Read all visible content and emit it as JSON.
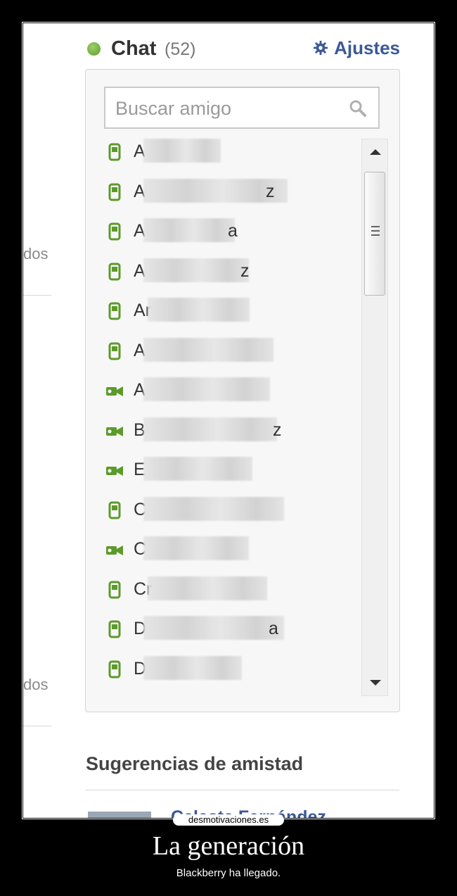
{
  "chat": {
    "title": "Chat",
    "count": "(52)",
    "settings_label": "Ajustes",
    "search_placeholder": "Buscar amigo"
  },
  "left_fragments": [
    "dos",
    "dos"
  ],
  "friends": [
    {
      "initial": "A",
      "device": "mobile-icon",
      "tail": ""
    },
    {
      "initial": "A",
      "device": "mobile-icon",
      "tail": "z"
    },
    {
      "initial": "A",
      "device": "mobile-icon",
      "tail": "a"
    },
    {
      "initial": "A",
      "device": "mobile-icon",
      "tail": "z"
    },
    {
      "initial": "Ar",
      "device": "mobile-icon",
      "tail": ""
    },
    {
      "initial": "A",
      "device": "mobile-icon",
      "tail": ""
    },
    {
      "initial": "A",
      "device": "video-icon",
      "tail": ""
    },
    {
      "initial": "B",
      "device": "video-icon",
      "tail": "z"
    },
    {
      "initial": "E",
      "device": "video-icon",
      "tail": ""
    },
    {
      "initial": "C",
      "device": "mobile-icon",
      "tail": ""
    },
    {
      "initial": "C",
      "device": "video-icon",
      "tail": ""
    },
    {
      "initial": "Cr",
      "device": "mobile-icon",
      "tail": ""
    },
    {
      "initial": "D",
      "device": "mobile-icon",
      "tail": "a"
    },
    {
      "initial": "D",
      "device": "mobile-icon",
      "tail": ""
    }
  ],
  "suggestions": {
    "title": "Sugerencias de amistad",
    "name": "Celeste Fernández"
  },
  "watermark": "desmotivaciones.es",
  "caption": {
    "title": "La generación",
    "subtitle": "Blackberry ha llegado."
  },
  "colors": {
    "online_green": "#5c9a2b",
    "link_blue": "#3b5998"
  }
}
